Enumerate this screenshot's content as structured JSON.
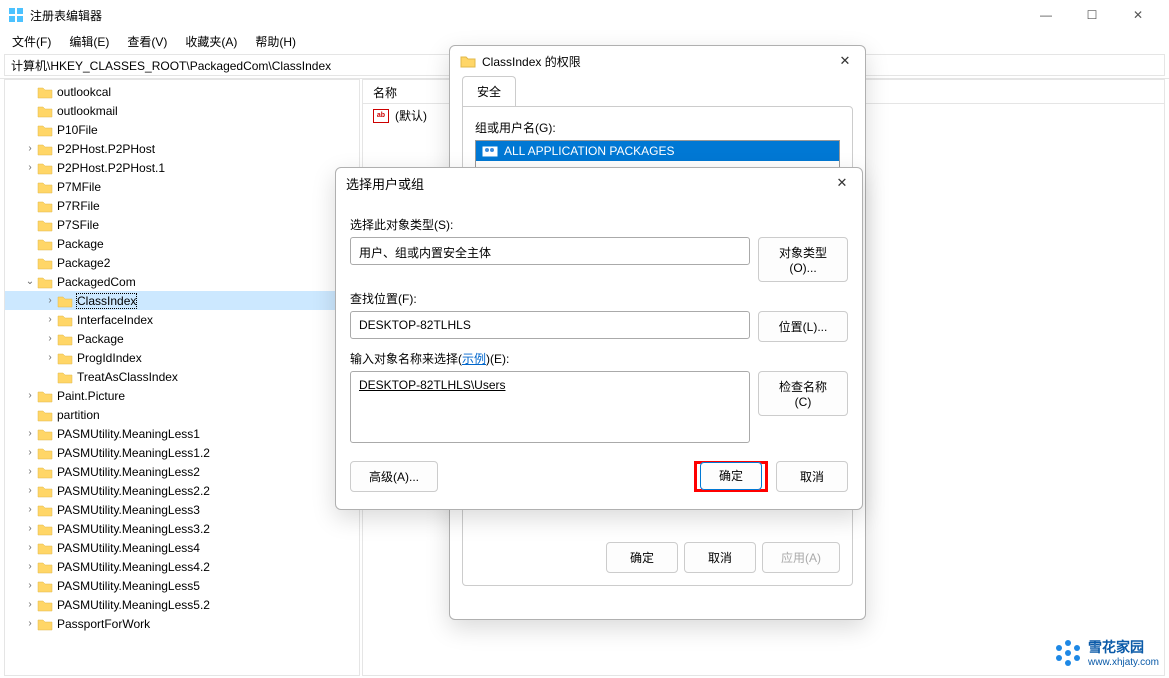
{
  "window": {
    "title": "注册表编辑器",
    "minimize": "—",
    "maximize": "☐",
    "close": "✕"
  },
  "menu": {
    "file": "文件(F)",
    "edit": "编辑(E)",
    "view": "查看(V)",
    "favorites": "收藏夹(A)",
    "help": "帮助(H)"
  },
  "address": "计算机\\HKEY_CLASSES_ROOT\\PackagedCom\\ClassIndex",
  "tree": [
    {
      "label": "outlookcal",
      "level": 1,
      "exp": ""
    },
    {
      "label": "outlookmail",
      "level": 1,
      "exp": ""
    },
    {
      "label": "P10File",
      "level": 1,
      "exp": ""
    },
    {
      "label": "P2PHost.P2PHost",
      "level": 1,
      "exp": ">"
    },
    {
      "label": "P2PHost.P2PHost.1",
      "level": 1,
      "exp": ">"
    },
    {
      "label": "P7MFile",
      "level": 1,
      "exp": ""
    },
    {
      "label": "P7RFile",
      "level": 1,
      "exp": ""
    },
    {
      "label": "P7SFile",
      "level": 1,
      "exp": ""
    },
    {
      "label": "Package",
      "level": 1,
      "exp": ""
    },
    {
      "label": "Package2",
      "level": 1,
      "exp": ""
    },
    {
      "label": "PackagedCom",
      "level": 1,
      "exp": "v"
    },
    {
      "label": "ClassIndex",
      "level": 2,
      "exp": ">",
      "selected": true
    },
    {
      "label": "InterfaceIndex",
      "level": 2,
      "exp": ">"
    },
    {
      "label": "Package",
      "level": 2,
      "exp": ">"
    },
    {
      "label": "ProgIdIndex",
      "level": 2,
      "exp": ">"
    },
    {
      "label": "TreatAsClassIndex",
      "level": 2,
      "exp": ""
    },
    {
      "label": "Paint.Picture",
      "level": 1,
      "exp": ">"
    },
    {
      "label": "partition",
      "level": 1,
      "exp": ""
    },
    {
      "label": "PASMUtility.MeaningLess1",
      "level": 1,
      "exp": ">"
    },
    {
      "label": "PASMUtility.MeaningLess1.2",
      "level": 1,
      "exp": ">"
    },
    {
      "label": "PASMUtility.MeaningLess2",
      "level": 1,
      "exp": ">"
    },
    {
      "label": "PASMUtility.MeaningLess2.2",
      "level": 1,
      "exp": ">"
    },
    {
      "label": "PASMUtility.MeaningLess3",
      "level": 1,
      "exp": ">"
    },
    {
      "label": "PASMUtility.MeaningLess3.2",
      "level": 1,
      "exp": ">"
    },
    {
      "label": "PASMUtility.MeaningLess4",
      "level": 1,
      "exp": ">"
    },
    {
      "label": "PASMUtility.MeaningLess4.2",
      "level": 1,
      "exp": ">"
    },
    {
      "label": "PASMUtility.MeaningLess5",
      "level": 1,
      "exp": ">"
    },
    {
      "label": "PASMUtility.MeaningLess5.2",
      "level": 1,
      "exp": ">"
    },
    {
      "label": "PassportForWork",
      "level": 1,
      "exp": ">"
    }
  ],
  "values": {
    "header_name": "名称",
    "default_name": "(默认)"
  },
  "perm_dialog": {
    "title": "ClassIndex 的权限",
    "tab": "安全",
    "groups_label": "组或用户名(G):",
    "group_item": "ALL APPLICATION PACKAGES",
    "ok": "确定",
    "cancel": "取消",
    "apply": "应用(A)"
  },
  "select_dialog": {
    "title": "选择用户或组",
    "type_label": "选择此对象类型(S):",
    "type_value": "用户、组或内置安全主体",
    "type_btn": "对象类型(O)...",
    "location_label": "查找位置(F):",
    "location_value": "DESKTOP-82TLHLS",
    "location_btn": "位置(L)...",
    "names_label_prefix": "输入对象名称来选择(",
    "names_label_link": "示例",
    "names_label_suffix": ")(E):",
    "names_value": "DESKTOP-82TLHLS\\Users",
    "check_btn": "检查名称(C)",
    "advanced_btn": "高级(A)...",
    "ok": "确定",
    "cancel": "取消"
  },
  "watermark": {
    "name": "雪花家园",
    "url": "www.xhjaty.com"
  }
}
